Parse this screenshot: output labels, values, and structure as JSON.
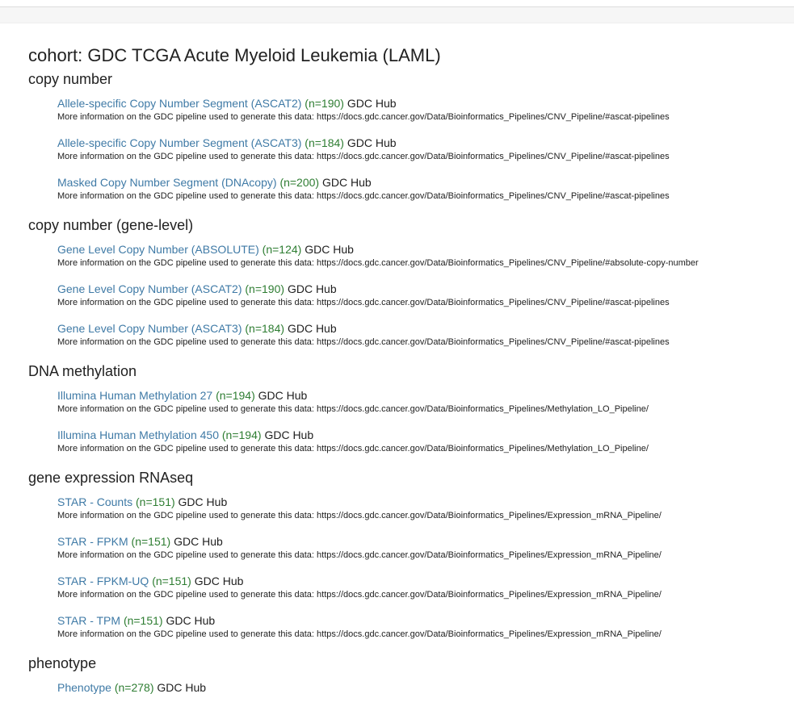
{
  "cohort_title": "cohort: GDC TCGA Acute Myeloid Leukemia (LAML)",
  "sections": [
    {
      "title": "copy number",
      "datasets": [
        {
          "name": "Allele-specific Copy Number Segment (ASCAT2)",
          "count": "(n=190)",
          "hub": "GDC Hub",
          "description": "More information on the GDC pipeline used to generate this data: https://docs.gdc.cancer.gov/Data/Bioinformatics_Pipelines/CNV_Pipeline/#ascat-pipelines"
        },
        {
          "name": "Allele-specific Copy Number Segment (ASCAT3)",
          "count": "(n=184)",
          "hub": "GDC Hub",
          "description": "More information on the GDC pipeline used to generate this data: https://docs.gdc.cancer.gov/Data/Bioinformatics_Pipelines/CNV_Pipeline/#ascat-pipelines"
        },
        {
          "name": "Masked Copy Number Segment (DNAcopy)",
          "count": "(n=200)",
          "hub": "GDC Hub",
          "description": "More information on the GDC pipeline used to generate this data: https://docs.gdc.cancer.gov/Data/Bioinformatics_Pipelines/CNV_Pipeline/#ascat-pipelines"
        }
      ]
    },
    {
      "title": "copy number (gene-level)",
      "datasets": [
        {
          "name": "Gene Level Copy Number (ABSOLUTE)",
          "count": "(n=124)",
          "hub": "GDC Hub",
          "description": "More information on the GDC pipeline used to generate this data: https://docs.gdc.cancer.gov/Data/Bioinformatics_Pipelines/CNV_Pipeline/#absolute-copy-number"
        },
        {
          "name": "Gene Level Copy Number (ASCAT2)",
          "count": "(n=190)",
          "hub": "GDC Hub",
          "description": "More information on the GDC pipeline used to generate this data: https://docs.gdc.cancer.gov/Data/Bioinformatics_Pipelines/CNV_Pipeline/#ascat-pipelines"
        },
        {
          "name": "Gene Level Copy Number (ASCAT3)",
          "count": "(n=184)",
          "hub": "GDC Hub",
          "description": "More information on the GDC pipeline used to generate this data: https://docs.gdc.cancer.gov/Data/Bioinformatics_Pipelines/CNV_Pipeline/#ascat-pipelines"
        }
      ]
    },
    {
      "title": "DNA methylation",
      "datasets": [
        {
          "name": "Illumina Human Methylation 27",
          "count": "(n=194)",
          "hub": "GDC Hub",
          "description": "More information on the GDC pipeline used to generate this data: https://docs.gdc.cancer.gov/Data/Bioinformatics_Pipelines/Methylation_LO_Pipeline/"
        },
        {
          "name": "Illumina Human Methylation 450",
          "count": "(n=194)",
          "hub": "GDC Hub",
          "description": "More information on the GDC pipeline used to generate this data: https://docs.gdc.cancer.gov/Data/Bioinformatics_Pipelines/Methylation_LO_Pipeline/"
        }
      ]
    },
    {
      "title": "gene expression RNAseq",
      "datasets": [
        {
          "name": "STAR - Counts",
          "count": "(n=151)",
          "hub": "GDC Hub",
          "description": "More information on the GDC pipeline used to generate this data: https://docs.gdc.cancer.gov/Data/Bioinformatics_Pipelines/Expression_mRNA_Pipeline/"
        },
        {
          "name": "STAR - FPKM",
          "count": "(n=151)",
          "hub": "GDC Hub",
          "description": "More information on the GDC pipeline used to generate this data: https://docs.gdc.cancer.gov/Data/Bioinformatics_Pipelines/Expression_mRNA_Pipeline/"
        },
        {
          "name": "STAR - FPKM-UQ",
          "count": "(n=151)",
          "hub": "GDC Hub",
          "description": "More information on the GDC pipeline used to generate this data: https://docs.gdc.cancer.gov/Data/Bioinformatics_Pipelines/Expression_mRNA_Pipeline/"
        },
        {
          "name": "STAR - TPM",
          "count": "(n=151)",
          "hub": "GDC Hub",
          "description": "More information on the GDC pipeline used to generate this data: https://docs.gdc.cancer.gov/Data/Bioinformatics_Pipelines/Expression_mRNA_Pipeline/"
        }
      ]
    },
    {
      "title": "phenotype",
      "datasets": [
        {
          "name": "Phenotype",
          "count": "(n=278)",
          "hub": "GDC Hub",
          "description": ""
        }
      ]
    }
  ],
  "colors": {
    "link": "#3f7aa6",
    "count": "#2e7d32",
    "text": "#212121"
  }
}
